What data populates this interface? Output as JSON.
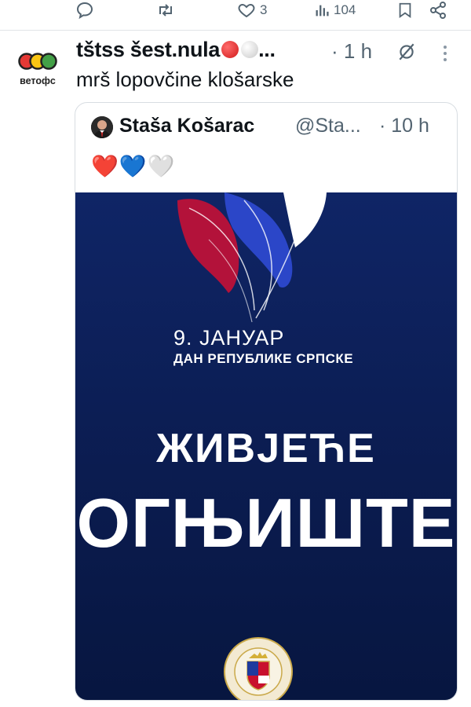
{
  "top_actions": {
    "reply_count": "",
    "retweet_count": "",
    "like_count": "3",
    "views_count": "104"
  },
  "tweet": {
    "author_name": "tštss šest.nula",
    "author_suffix": "...",
    "time": "· 1 h",
    "text": "mrš lopovčine klošarske",
    "avatar_label": "ветофс"
  },
  "quote": {
    "author_name": "Staša Košarac",
    "handle": "@Sta...",
    "time": "· 10 h",
    "text": "❤️💙🤍",
    "image": {
      "date": "9. ЈАНУАР",
      "subtitle": "ДАН РЕПУБЛИКЕ СРПСКЕ",
      "line1": "ЖИВЈЕЋЕ",
      "line2": "ОГЊИШТЕ"
    }
  },
  "colors": {
    "text": "#0f1419",
    "muted": "#536471",
    "image_bg": "#0f2566",
    "flag_red": "#c8102e",
    "flag_blue": "#2b46c8"
  }
}
